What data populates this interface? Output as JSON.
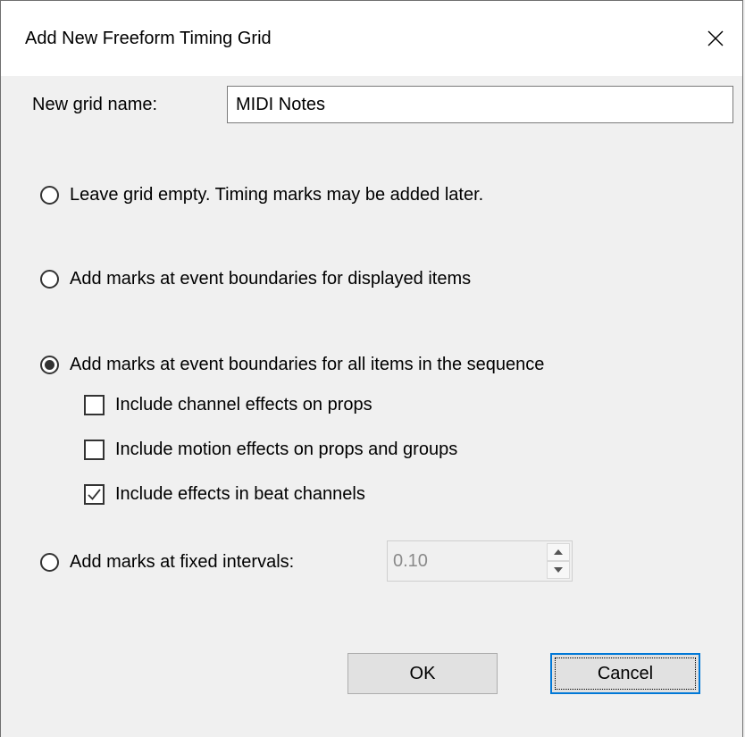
{
  "window": {
    "title": "Add New Freeform Timing Grid",
    "close_icon": "close-icon"
  },
  "name_field": {
    "label": "New grid name:",
    "value": "MIDI Notes"
  },
  "options": {
    "leave_empty": "Leave grid empty. Timing marks may be added later.",
    "displayed_items": "Add marks at event boundaries for displayed items",
    "all_items": "Add marks at event boundaries for all items in the sequence",
    "fixed_intervals": "Add marks at fixed intervals:",
    "selected": "all_items"
  },
  "checkboxes": {
    "channel_effects": {
      "label": "Include channel effects on props",
      "checked": false
    },
    "motion_effects": {
      "label": "Include motion effects on props and groups",
      "checked": false
    },
    "beat_channels": {
      "label": "Include effects in beat channels",
      "checked": true
    }
  },
  "interval": {
    "value": "0.10"
  },
  "buttons": {
    "ok": "OK",
    "cancel": "Cancel"
  },
  "colors": {
    "focus": "#0078d7",
    "background": "#f0f0f0"
  }
}
